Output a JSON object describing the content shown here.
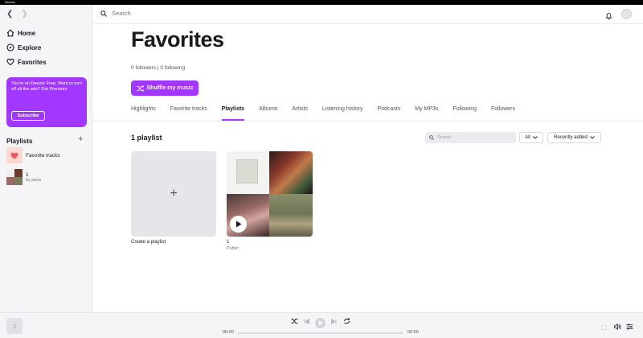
{
  "app": {
    "title": "Deezer"
  },
  "nav": {
    "back_icon": "chevron-left-icon",
    "forward_icon": "chevron-right-icon",
    "items": [
      {
        "label": "Home",
        "icon": "home-icon"
      },
      {
        "label": "Explore",
        "icon": "compass-icon"
      },
      {
        "label": "Favorites",
        "icon": "heart-icon"
      }
    ]
  },
  "promo": {
    "text": "You're on Deezer Free. Want to turn off all the ads? Get Premium",
    "button": "Subscribe"
  },
  "sidebar_playlists": {
    "heading": "Playlists",
    "items": [
      {
        "title": "Favorite tracks",
        "subtitle": ""
      },
      {
        "title": "1",
        "subtitle": "by jame"
      }
    ]
  },
  "topbar": {
    "search_placeholder": "Search"
  },
  "page": {
    "title": "Favorites",
    "followers": "0 followers | 0 following",
    "shuffle_label": "Shuffle my music"
  },
  "tabs": [
    {
      "label": "Highlights",
      "active": false
    },
    {
      "label": "Favorite tracks",
      "active": false
    },
    {
      "label": "Playlists",
      "active": true
    },
    {
      "label": "Albums",
      "active": false
    },
    {
      "label": "Artists",
      "active": false
    },
    {
      "label": "Listening history",
      "active": false
    },
    {
      "label": "Podcasts",
      "active": false
    },
    {
      "label": "My MP3s",
      "active": false
    },
    {
      "label": "Following",
      "active": false
    },
    {
      "label": "Followers",
      "active": false
    }
  ],
  "playlists_section": {
    "count": "1 playlist",
    "search_placeholder": "Search",
    "filter": "All",
    "sort": "Recently added",
    "create_label": "Create a playlist",
    "playlist": {
      "name": "1",
      "visibility": "Public"
    }
  },
  "player": {
    "elapsed": "00:00",
    "duration": "00:00",
    "progress": 0
  },
  "colors": {
    "accent": "#a238ff",
    "favorite_bg": "#ffd8cf",
    "heart": "#ef5466"
  }
}
